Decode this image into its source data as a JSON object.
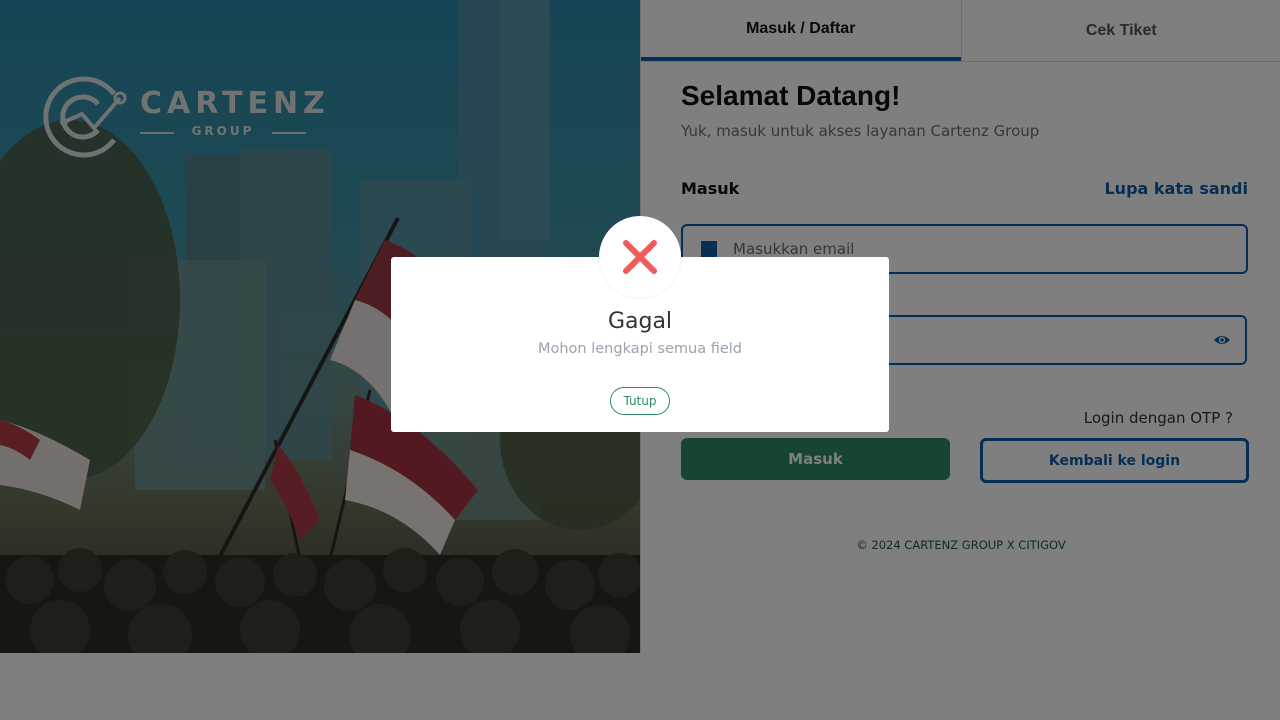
{
  "hero": {
    "logo_word": "CARTENZ",
    "logo_sub": "GROUP"
  },
  "tabs": [
    {
      "label": "Masuk / Daftar",
      "active": true
    },
    {
      "label": "Cek Tiket",
      "active": false
    }
  ],
  "form": {
    "title": "Selamat Datang!",
    "subtitle": "Yuk, masuk untuk akses layanan Cartenz Group",
    "section_label": "Masuk",
    "forgot_password": "Lupa kata sandi",
    "email_placeholder": "Masukkan email",
    "email_value": "",
    "password_value": "",
    "otp_link": "Login dengan OTP ?",
    "login_button": "Masuk",
    "back_button": "Kembali ke login",
    "icons": {
      "email": "mail-icon",
      "password_toggle": "eye-icon"
    }
  },
  "footer": {
    "text": "© 2024 CARTENZ GROUP X CITIGOV"
  },
  "modal": {
    "icon": "error-x-icon",
    "title": "Gagal",
    "message": "Mohon lengkapi semua field",
    "button": "Tutup"
  },
  "colors": {
    "primary_blue": "#0d5ca8",
    "primary_green": "#2e8b63",
    "error_red": "#f05a5a"
  }
}
